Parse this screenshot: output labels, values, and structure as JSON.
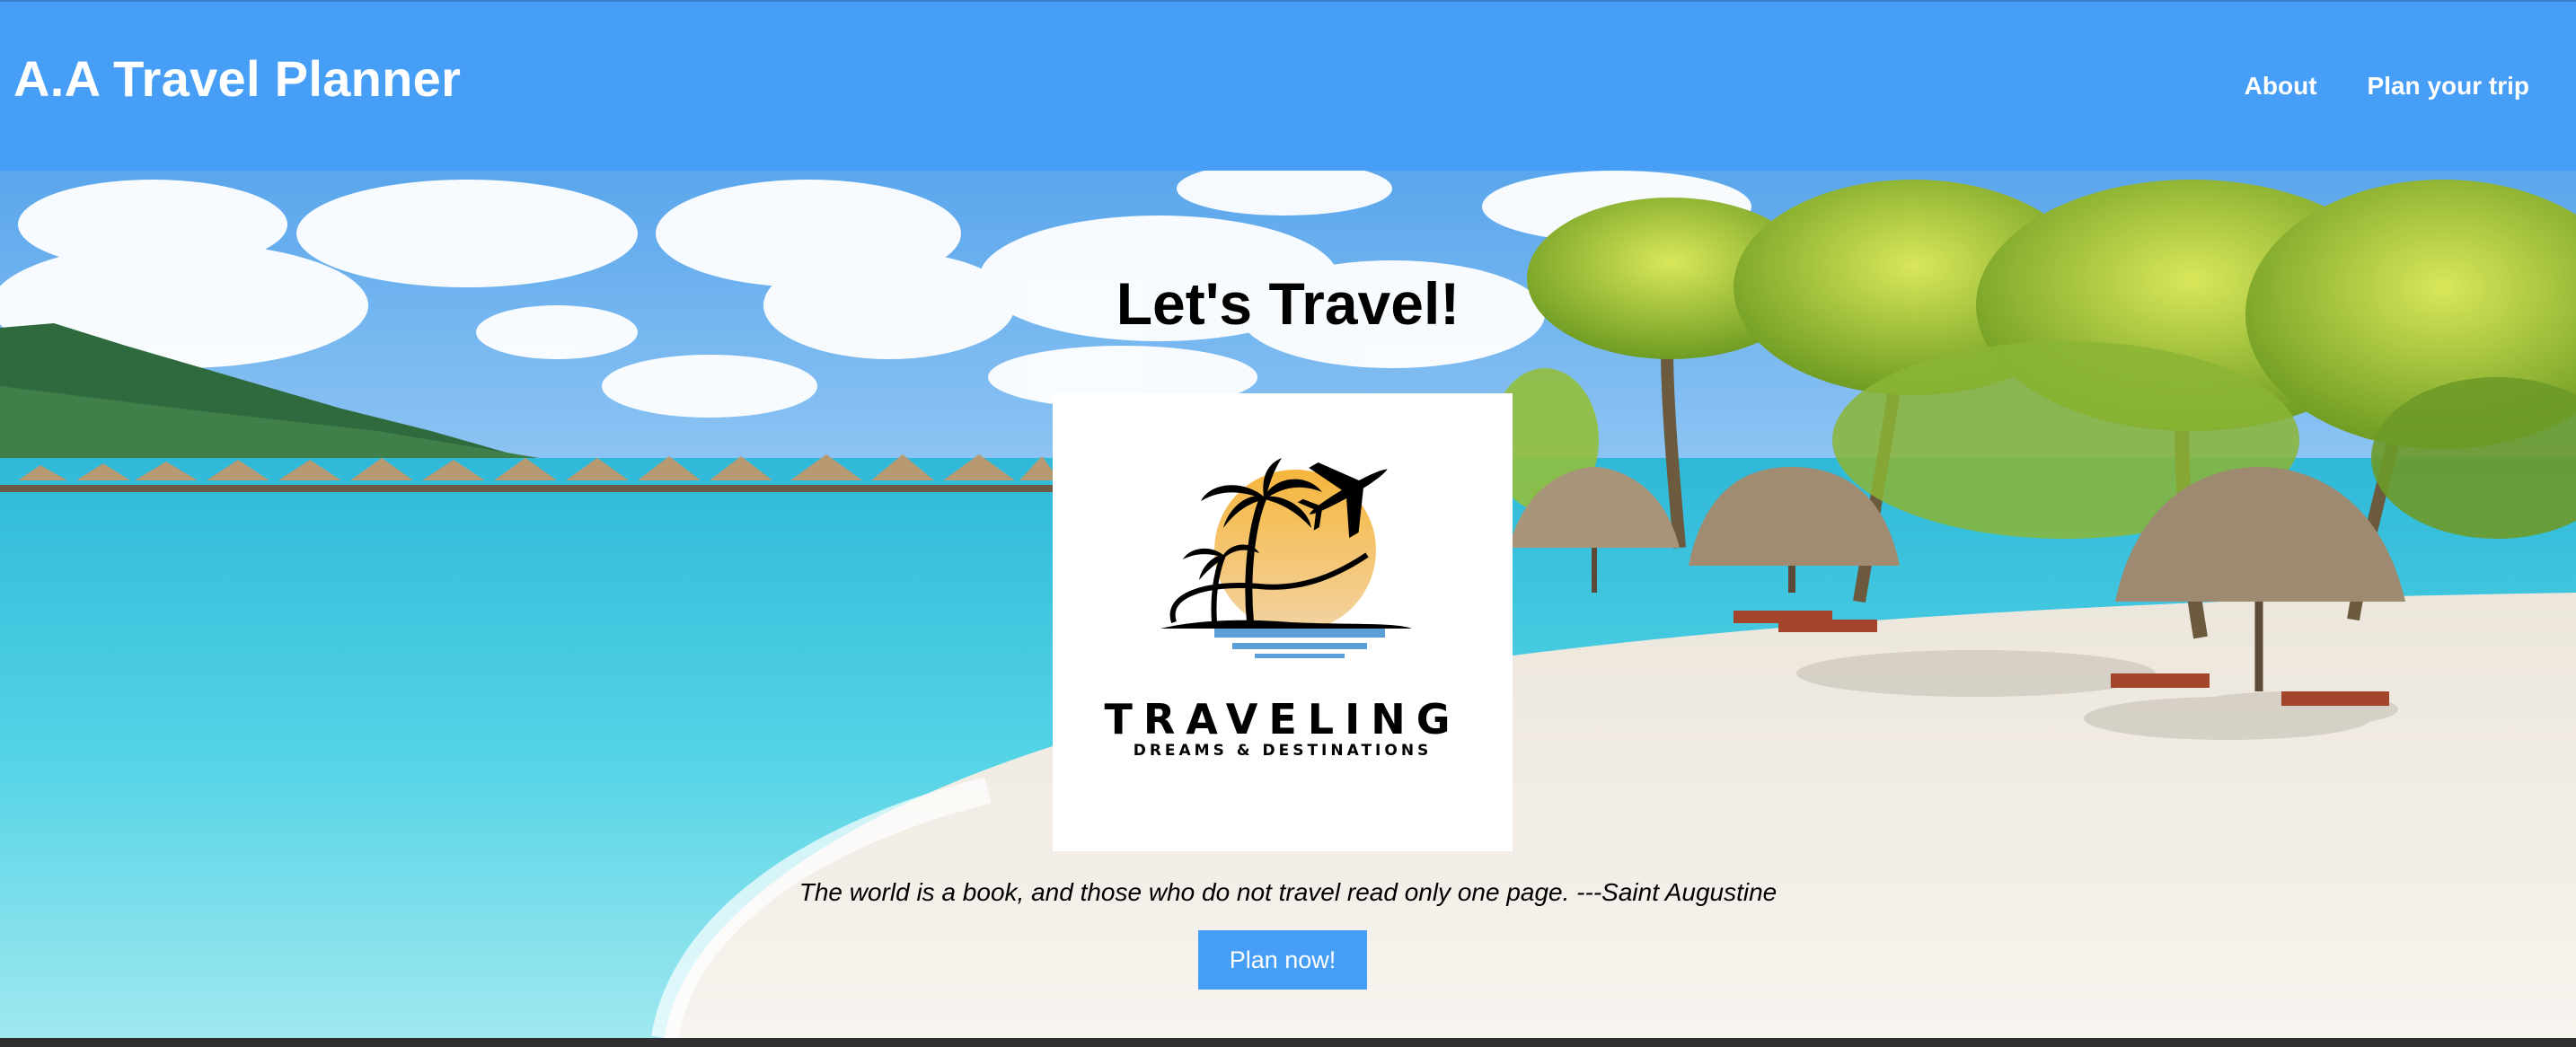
{
  "header": {
    "brand": "A.A Travel Planner",
    "nav": [
      {
        "label": "About"
      },
      {
        "label": "Plan your trip"
      }
    ]
  },
  "hero": {
    "title": "Let's Travel!",
    "logo": {
      "word": "TRAVELING",
      "tagline": "DREAMS & DESTINATIONS",
      "icons": [
        "palm-tree-icon",
        "airplane-icon",
        "sun-icon"
      ]
    },
    "quote": "The world is a book, and those who do not travel read only one page. ---Saint Augustine",
    "cta_label": "Plan now!"
  },
  "colors": {
    "header_bg": "#479ef6",
    "button_bg": "#479ef6",
    "text_light": "#ffffff"
  }
}
